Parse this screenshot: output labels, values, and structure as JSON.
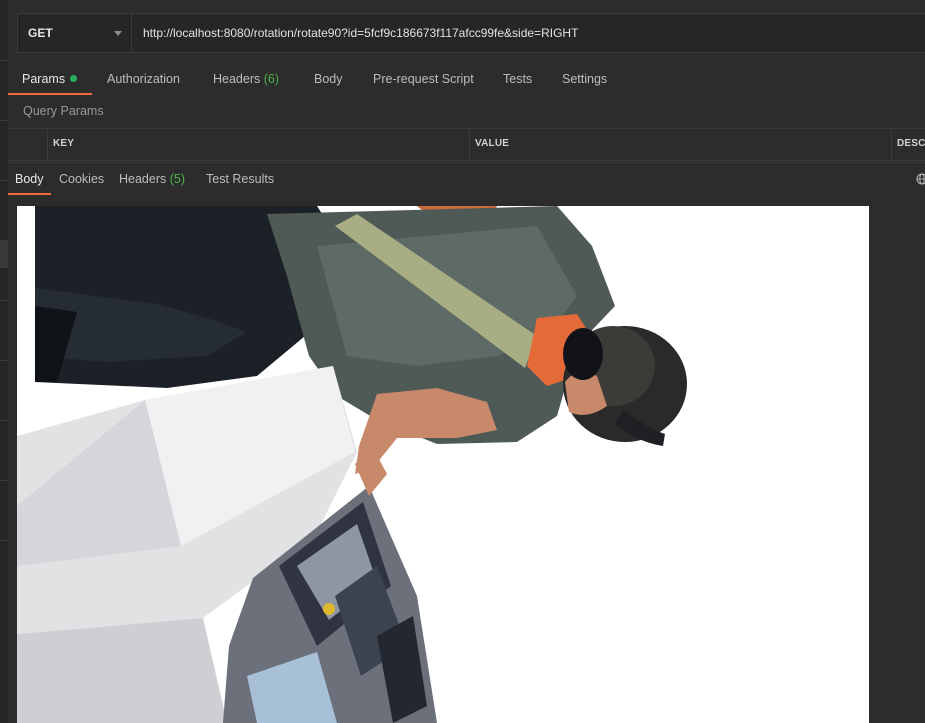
{
  "request": {
    "method": "GET",
    "url": "http://localhost:8080/rotation/rotate90?id=5fcf9c186673f117afcc99fe&side=RIGHT"
  },
  "request_tabs": {
    "params": "Params",
    "authorization": "Authorization",
    "headers": "Headers",
    "headers_count": "(6)",
    "body": "Body",
    "pre_request_script": "Pre-request Script",
    "tests": "Tests",
    "settings": "Settings"
  },
  "query_params": {
    "label": "Query Params",
    "columns": [
      "KEY",
      "VALUE",
      "DESCI"
    ]
  },
  "response_tabs": {
    "body": "Body",
    "cookies": "Cookies",
    "headers": "Headers",
    "headers_count": "(5)",
    "test_results": "Test Results"
  },
  "icons": {
    "method_dropdown": "chevron-down-icon",
    "network": "globe-icon"
  },
  "colors": {
    "accent": "#f26b3a",
    "count_green": "#4cb14c",
    "status_dot": "#26b060",
    "background": "#2c2c2c"
  }
}
